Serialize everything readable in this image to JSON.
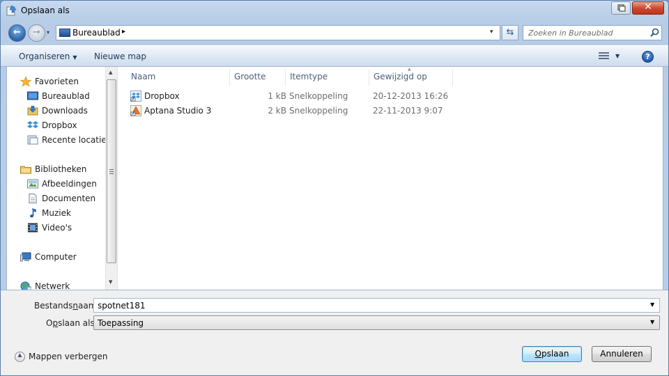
{
  "window": {
    "title": "Opslaan als",
    "close_glyph": "✕",
    "restore_glyph": "⧉"
  },
  "address": {
    "location": "Bureaublad",
    "separator": "▸",
    "dropdown_glyph": "▾",
    "refresh_glyph": "⇆"
  },
  "nav": {
    "back_glyph": "←",
    "forward_glyph": "→",
    "history_glyph": "▾"
  },
  "search": {
    "placeholder": "Zoeken in Bureaublad",
    "icon": "search-icon"
  },
  "toolbar": {
    "organize_label": "Organiseren",
    "organize_caret": "▼",
    "new_folder_label": "Nieuwe map",
    "view_drop": "▼",
    "help_glyph": "?"
  },
  "sidebar": {
    "groups": [
      {
        "label": "Favorieten",
        "icon": "star-icon",
        "items": [
          {
            "label": "Bureaublad",
            "icon": "desktop-icon"
          },
          {
            "label": "Downloads",
            "icon": "downloads-icon"
          },
          {
            "label": "Dropbox",
            "icon": "dropbox-icon"
          },
          {
            "label": "Recente locaties",
            "icon": "recent-places-icon"
          }
        ]
      },
      {
        "label": "Bibliotheken",
        "icon": "libraries-icon",
        "items": [
          {
            "label": "Afbeeldingen",
            "icon": "pictures-icon"
          },
          {
            "label": "Documenten",
            "icon": "documents-icon"
          },
          {
            "label": "Muziek",
            "icon": "music-icon"
          },
          {
            "label": "Video's",
            "icon": "videos-icon"
          }
        ]
      },
      {
        "label": "Computer",
        "icon": "computer-icon",
        "items": []
      },
      {
        "label": "Netwerk",
        "icon": "network-icon",
        "items": []
      }
    ]
  },
  "columns": {
    "name": "Naam",
    "size": "Grootte",
    "type": "Itemtype",
    "modified": "Gewijzigd op",
    "sort_glyph": "▲"
  },
  "files": [
    {
      "name": "Dropbox",
      "size": "1 kB",
      "type": "Snelkoppeling",
      "modified": "20-12-2013 16:26",
      "icon": "dropbox-shortcut-icon"
    },
    {
      "name": "Aptana Studio 3",
      "size": "2 kB",
      "type": "Snelkoppeling",
      "modified": "22-11-2013 9:07",
      "icon": "aptana-shortcut-icon"
    }
  ],
  "form": {
    "filename_label_pre": "Bestands",
    "filename_label_ul": "n",
    "filename_label_post": "aam:",
    "filename_value": "spotnet181",
    "savetype_label_pre": "O",
    "savetype_label_ul": "p",
    "savetype_label_post": "slaan als:",
    "savetype_value": "Toepassing",
    "dropdown_glyph": "▼"
  },
  "footer": {
    "hide_folders_label": "Mappen verbergen",
    "hide_folders_glyph": "▲",
    "save_label_ul": "O",
    "save_label_rest": "pslaan",
    "cancel_label": "Annuleren"
  },
  "colors": {
    "accent": "#3c7fb1",
    "close_red": "#c0341c",
    "link_text": "#1e395b"
  }
}
